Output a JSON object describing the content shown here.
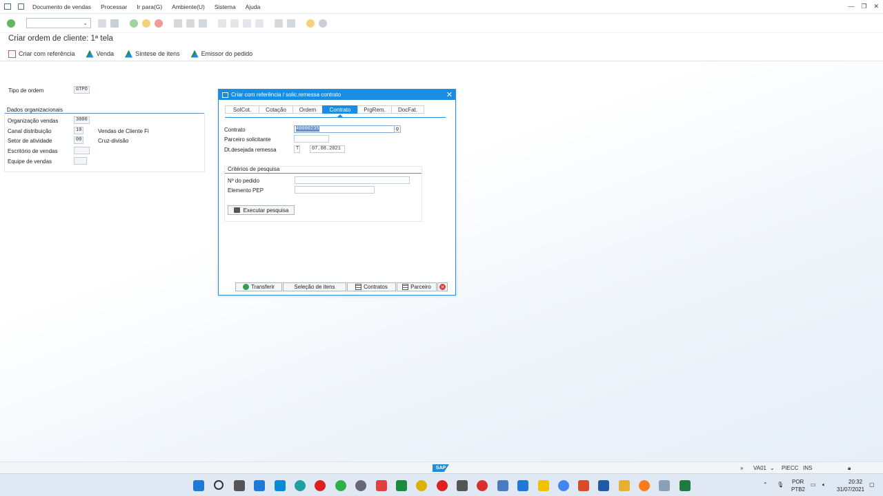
{
  "menubar": {
    "items": [
      "Documento de vendas",
      "Processar",
      "Ir para(G)",
      "Ambiente(U)",
      "Sistema",
      "Ajuda"
    ]
  },
  "screen": {
    "title": "Criar ordem de cliente: 1ª tela"
  },
  "app_toolbar": {
    "buttons": [
      "Criar com referência",
      "Venda",
      "Síntese de itens",
      "Emissor do pedido"
    ]
  },
  "form": {
    "tipo_ordem_label": "Tipo de ordem",
    "tipo_ordem_value": "GTPO",
    "group_title": "Dados organizacionais",
    "org_vendas_label": "Organização vendas",
    "org_vendas_value": "3000",
    "canal_label": "Canal distribuição",
    "canal_value": "10",
    "canal_desc": "Vendas de Cliente Fi",
    "setor_label": "Setor de atividade",
    "setor_value": "00",
    "setor_desc": "Cruz-divisão",
    "escritorio_label": "Escritório de vendas",
    "equipe_label": "Equipe de vendas"
  },
  "dialog": {
    "title": "Criar com referência / solic.remessa contrato",
    "tabs": [
      "SolCot.",
      "Cotação",
      "Ordem",
      "Contrato",
      "PrgRem.",
      "DocFat."
    ],
    "active_tab": "Contrato",
    "contrato_label": "Contrato",
    "contrato_value": "40000235",
    "parceiro_label": "Parceiro solicitante",
    "dt_label": "Dt.desejada remessa",
    "dt_type": "T",
    "dt_value": "07.08.2021",
    "criterios_title": "Critérios de pesquisa",
    "pedido_label": "Nº do pedido",
    "pep_label": "Elemento PEP",
    "exec_button": "Executar pesquisa",
    "footer": {
      "transferir": "Transferir",
      "selecao": "Seleção de itens",
      "contratos": "Contratos",
      "parceiro": "Parceiro"
    }
  },
  "statusbar": {
    "transaction": "VA01",
    "system": "PIECC",
    "mode": "INS",
    "logo": "SAP"
  },
  "taskbar": {
    "lang1": "POR",
    "lang2": "PTB2",
    "time": "20:32",
    "date": "31/07/2021"
  }
}
